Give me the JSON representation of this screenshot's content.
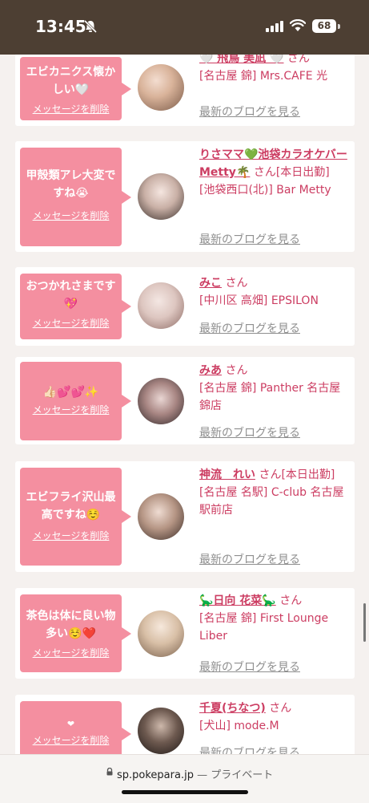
{
  "status_bar": {
    "time": "13:45",
    "battery": "68",
    "icons": [
      "mute-bell-icon",
      "cellular-signal-icon",
      "wifi-icon",
      "battery-icon"
    ]
  },
  "feed": {
    "items": [
      {
        "message": "エビカニクス懐かしい🤍",
        "delete_label": "メッセージを削除",
        "name": "🤍 飛鳥 美凪 🤍",
        "san": "さん",
        "shop": "[名古屋 錦] Mrs.CAFE 光",
        "blog": "最新のブログを見る"
      },
      {
        "message": "甲殻類アレ大変ですね😭",
        "delete_label": "メッセージを削除",
        "name": "りさママ💚池袋カラオケバーMetty🌴",
        "san": "さん[本日出勤]",
        "shop": "[池袋西口(北)] Bar Metty",
        "blog": "最新のブログを見る"
      },
      {
        "message": "おつかれさまです💖",
        "delete_label": "メッセージを削除",
        "name": "みこ",
        "san": "さん",
        "shop": "[中川区 高畑] EPSILON",
        "blog": "最新のブログを見る"
      },
      {
        "message": "👍🏻💕💕✨",
        "delete_label": "メッセージを削除",
        "name": "みあ",
        "san": "さん",
        "shop": "[名古屋 錦] Panther 名古屋錦店",
        "blog": "最新のブログを見る"
      },
      {
        "message": "エビフライ沢山最高ですね☺️",
        "delete_label": "メッセージを削除",
        "name": "神流　れい",
        "san": "さん[本日出勤]",
        "shop": "[名古屋 名駅] C-club 名古屋駅前店",
        "blog": "最新のブログを見る"
      },
      {
        "message": "茶色は体に良い物多い☺️❤️",
        "delete_label": "メッセージを削除",
        "name": "🦕日向 花菜🦕",
        "san": "さん",
        "shop": "[名古屋 錦] First Lounge Liber",
        "blog": "最新のブログを見る"
      },
      {
        "message": "❤",
        "delete_label": "メッセージを削除",
        "name": "千夏(ちなつ)",
        "san": "さん",
        "shop": "[犬山] mode.M",
        "blog": "最新のブログを見る"
      }
    ]
  },
  "url_bar": {
    "domain": "sp.pokepara.jp",
    "separator": "—",
    "mode": "プライベート"
  },
  "colors": {
    "accent": "#cc3d62",
    "bubble": "#f48fa0",
    "status_bar": "#4d3f33"
  }
}
